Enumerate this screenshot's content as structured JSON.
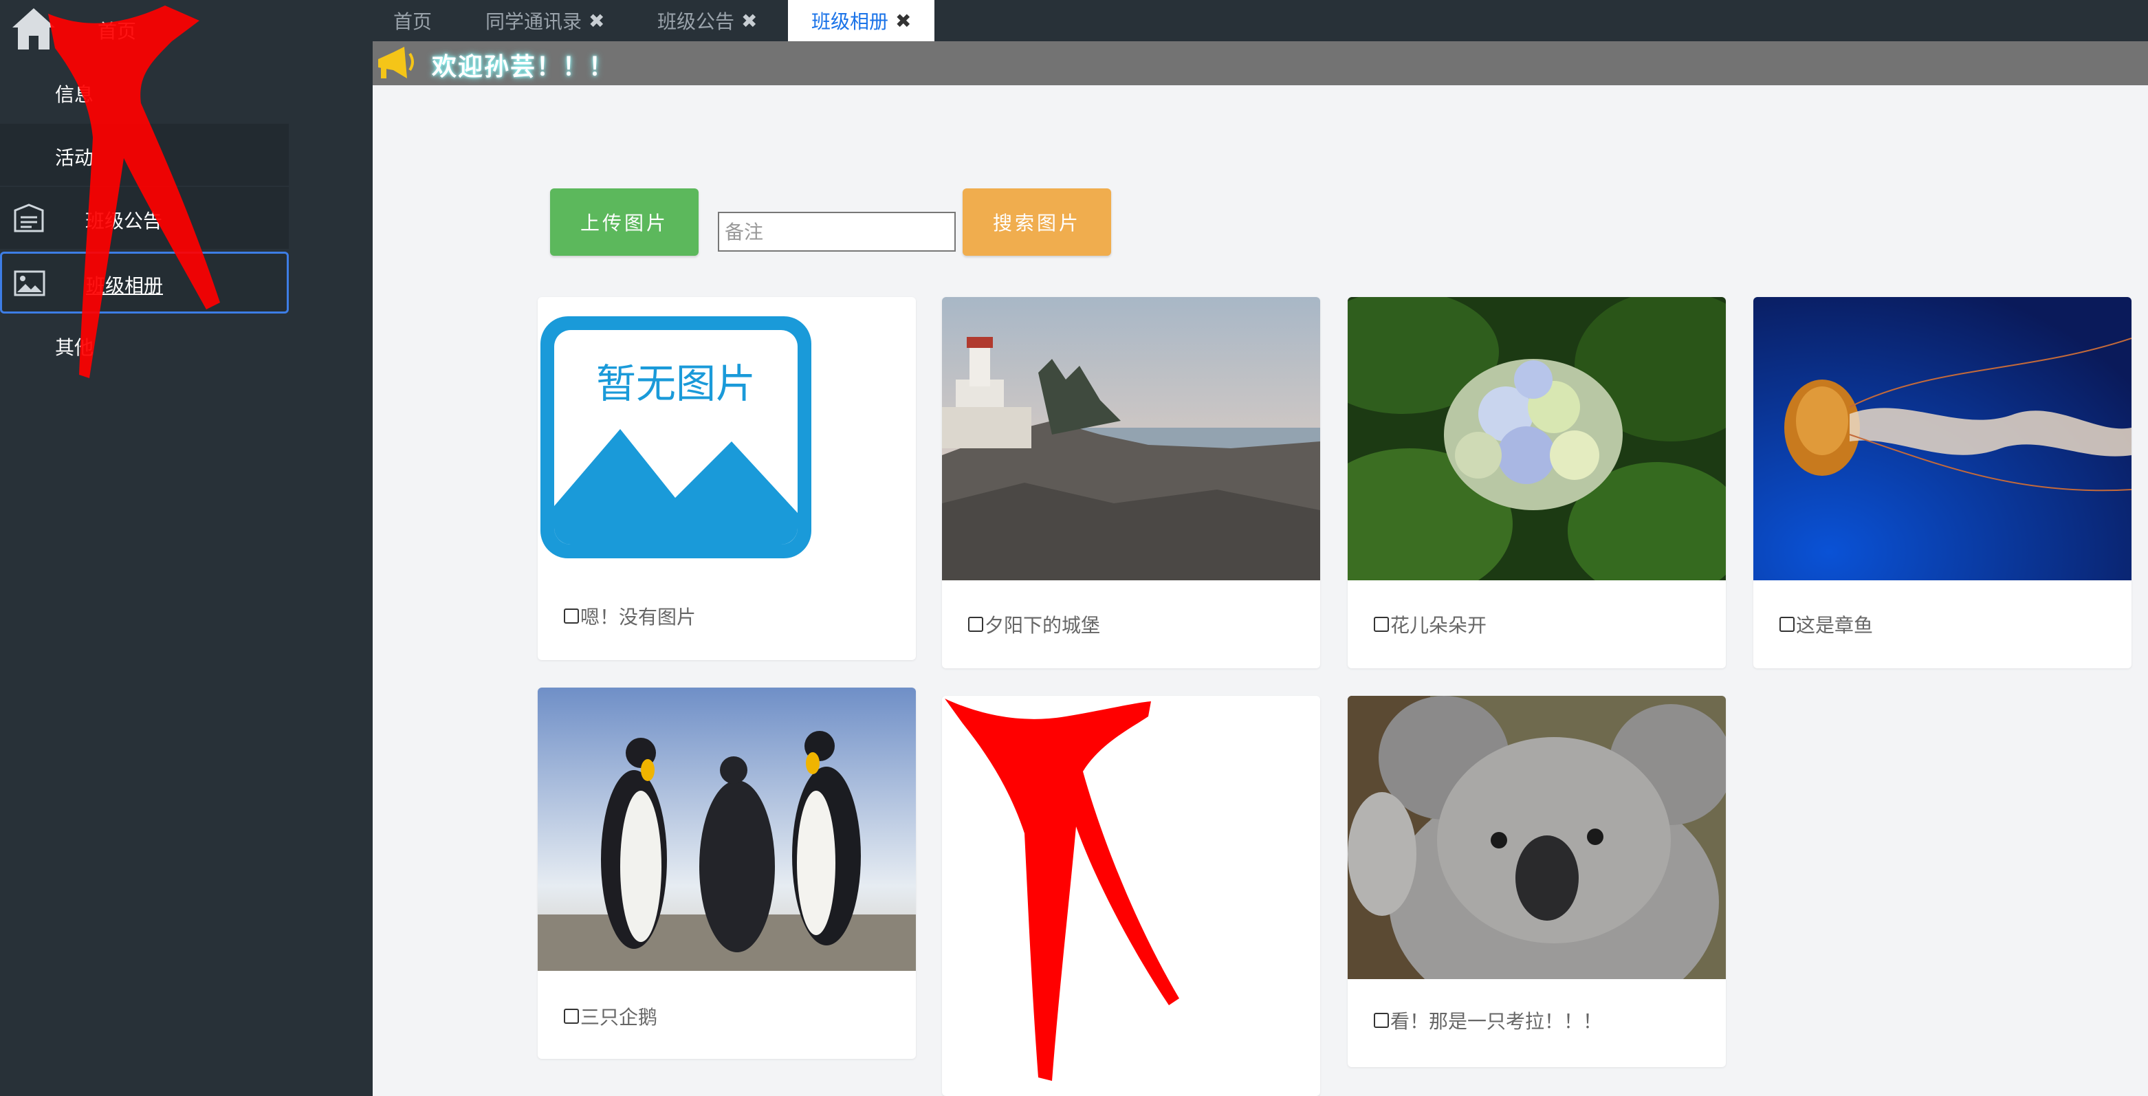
{
  "sidebar": {
    "items": [
      {
        "label": "首页"
      },
      {
        "label": "信息"
      },
      {
        "label": "活动"
      },
      {
        "label": "班级公告"
      },
      {
        "label": "班级相册"
      },
      {
        "label": "其他"
      }
    ]
  },
  "tabs": [
    {
      "label": "首页"
    },
    {
      "label": "同学通讯录",
      "close": "✖"
    },
    {
      "label": "班级公告",
      "close": "✖"
    },
    {
      "label": "班级相册",
      "close": "✖"
    }
  ],
  "announcement": {
    "text": "欢迎孙芸！！！",
    "icon": "megaphone-icon"
  },
  "toolbar": {
    "upload_label": "上传图片",
    "note_placeholder": "备注",
    "note_value": "",
    "search_label": "搜索图片"
  },
  "photos": [
    {
      "caption": "嗯！没有图片",
      "placeholder_text": "暂无图片",
      "image": "no-image-placeholder"
    },
    {
      "caption": "夕阳下的城堡",
      "image": "lighthouse-photo"
    },
    {
      "caption": "花儿朵朵开",
      "image": "hydrangea-photo"
    },
    {
      "caption": "这是章鱼",
      "image": "jellyfish-photo"
    },
    {
      "caption": "三只企鹅",
      "image": "penguins-photo"
    },
    {
      "caption": "",
      "image": "red-scarf-photo"
    },
    {
      "caption": "看！那是一只考拉！！！",
      "image": "koala-photo"
    }
  ],
  "colors": {
    "sidebar": "#283138",
    "active_tab_text": "#1a73e8",
    "upload_button": "#5cb85c",
    "search_button": "#f0ad4e",
    "announce_bar": "#737373"
  }
}
